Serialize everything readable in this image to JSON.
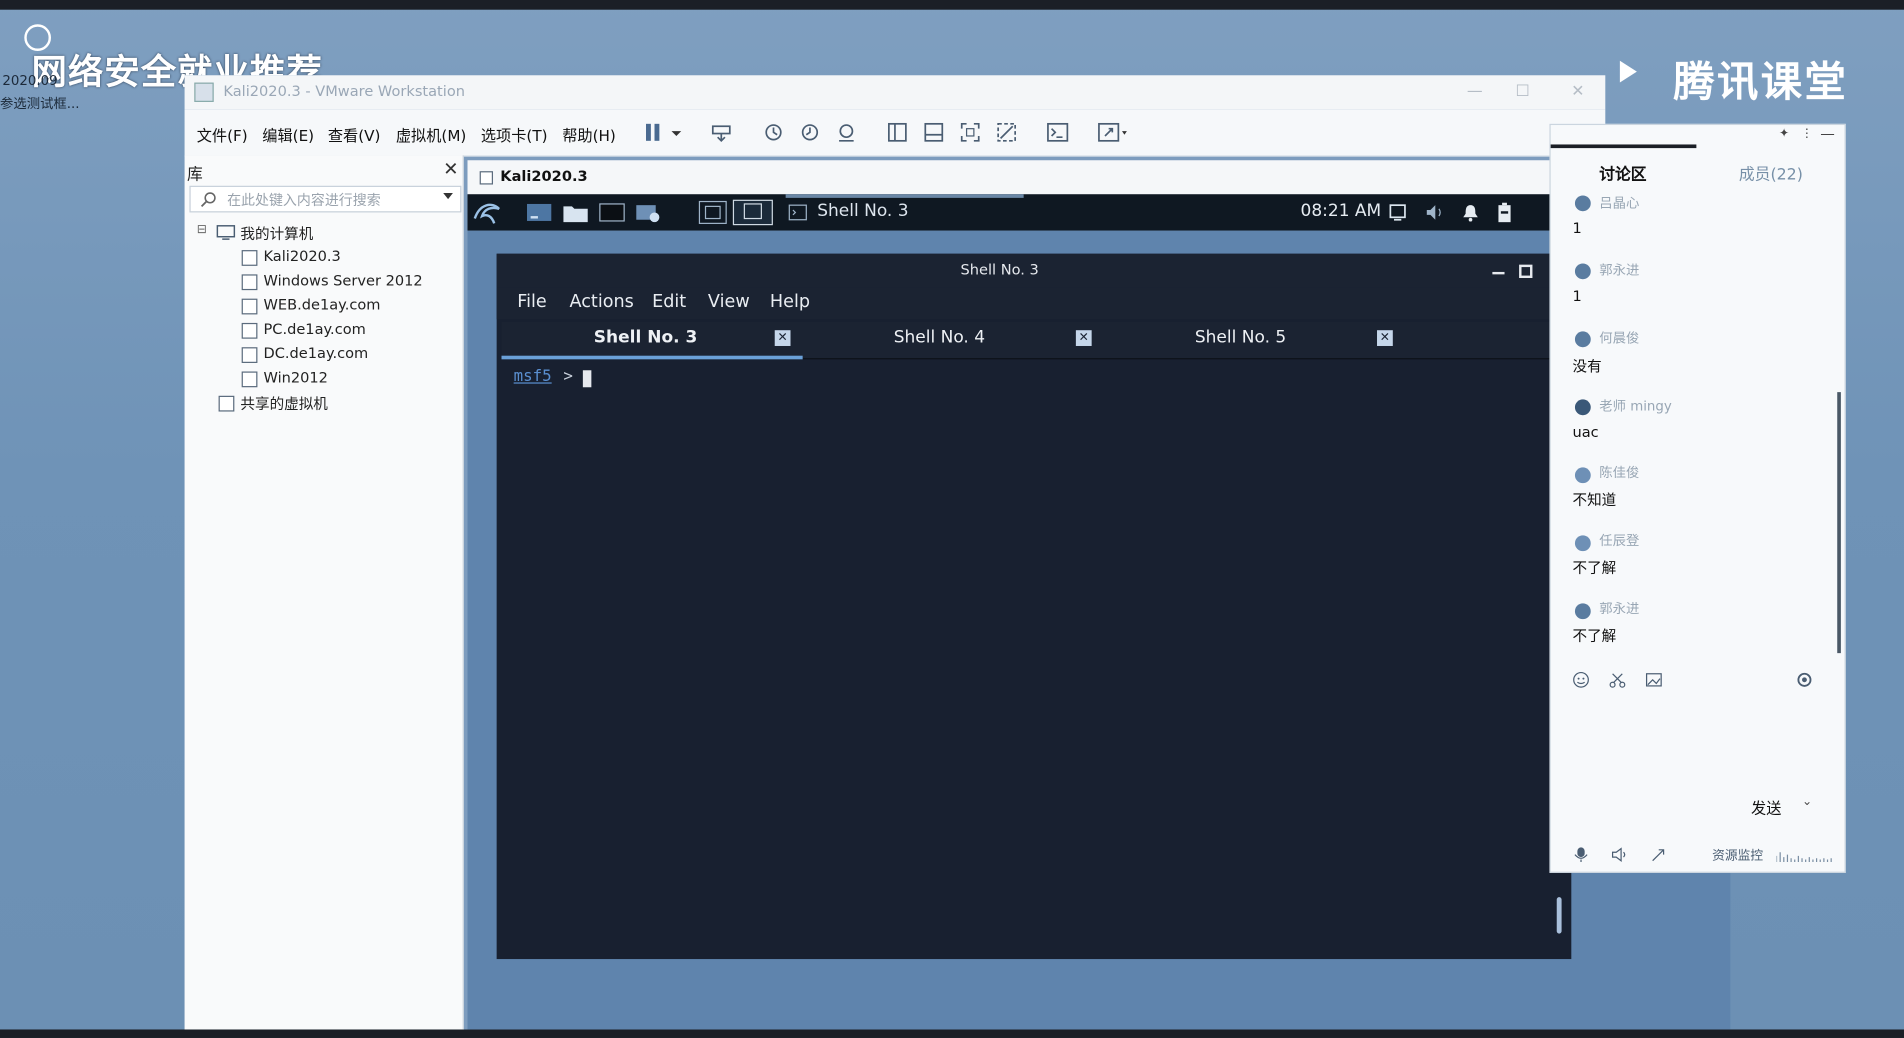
{
  "overlay": {
    "title": "网络安全就业推荐",
    "date": "2020.09",
    "subtitle": "参选测试框...",
    "brand": "腾讯课堂"
  },
  "vmware": {
    "title": "Kali2020.3 - VMware Workstation",
    "window_controls": [
      "—",
      "☐",
      "✕"
    ],
    "menu": [
      "文件(F)",
      "编辑(E)",
      "查看(V)",
      "虚拟机(M)",
      "选项卡(T)",
      "帮助(H)"
    ],
    "toolbar_icons": [
      "pause-icon",
      "dropdown-icon",
      "send-keys-icon",
      "snapshot-icon",
      "snapshot-restore-icon",
      "snapshot-manager-icon",
      "view-console-icon",
      "view-thumb-icon",
      "fullscreen-icon",
      "unity-icon",
      "terminal-icon",
      "stretch-icon"
    ],
    "library": {
      "label": "库",
      "close": "✕",
      "search_placeholder": "在此处键入内容进行搜索",
      "tree": {
        "root": "我的计算机",
        "items": [
          "Kali2020.3",
          "Windows Server 2012",
          "WEB.de1ay.com",
          "PC.de1ay.com",
          "DC.de1ay.com",
          "Win2012"
        ],
        "shared": "共享的虚拟机"
      }
    },
    "vm_tab": "Kali2020.3"
  },
  "kali": {
    "taskbar_window": "Shell No. 3",
    "clock": "08:21 AM"
  },
  "terminal": {
    "title": "Shell No. 3",
    "menu": [
      "File",
      "Actions",
      "Edit",
      "View",
      "Help"
    ],
    "tabs": [
      {
        "label": "Shell No. 3",
        "active": true
      },
      {
        "label": "Shell No. 4",
        "active": false
      },
      {
        "label": "Shell No. 5",
        "active": false
      }
    ],
    "tab_close": "✕",
    "prompt": "msf5",
    "prompt_arrow": ">"
  },
  "chat": {
    "tabs": {
      "discuss": "讨论区",
      "members": "成员(22)"
    },
    "messages": [
      {
        "name": "吕晶心",
        "text": "1"
      },
      {
        "name": "郭永进",
        "text": "1"
      },
      {
        "name": "何晨俊",
        "text": "没有"
      },
      {
        "name": "老师 mingy",
        "text": "uac"
      },
      {
        "name": "陈佳俊",
        "text": "不知道"
      },
      {
        "name": "任辰登",
        "text": "不了解"
      },
      {
        "name": "郭永进",
        "text": "不了解"
      }
    ],
    "send_label": "发送",
    "monitor_label": "资源监控"
  },
  "colors": {
    "desktop": "#6f93b7",
    "terminal_bg": "#182030",
    "kali_panel": "#0f1822",
    "tab_accent": "#6aa0d8"
  }
}
